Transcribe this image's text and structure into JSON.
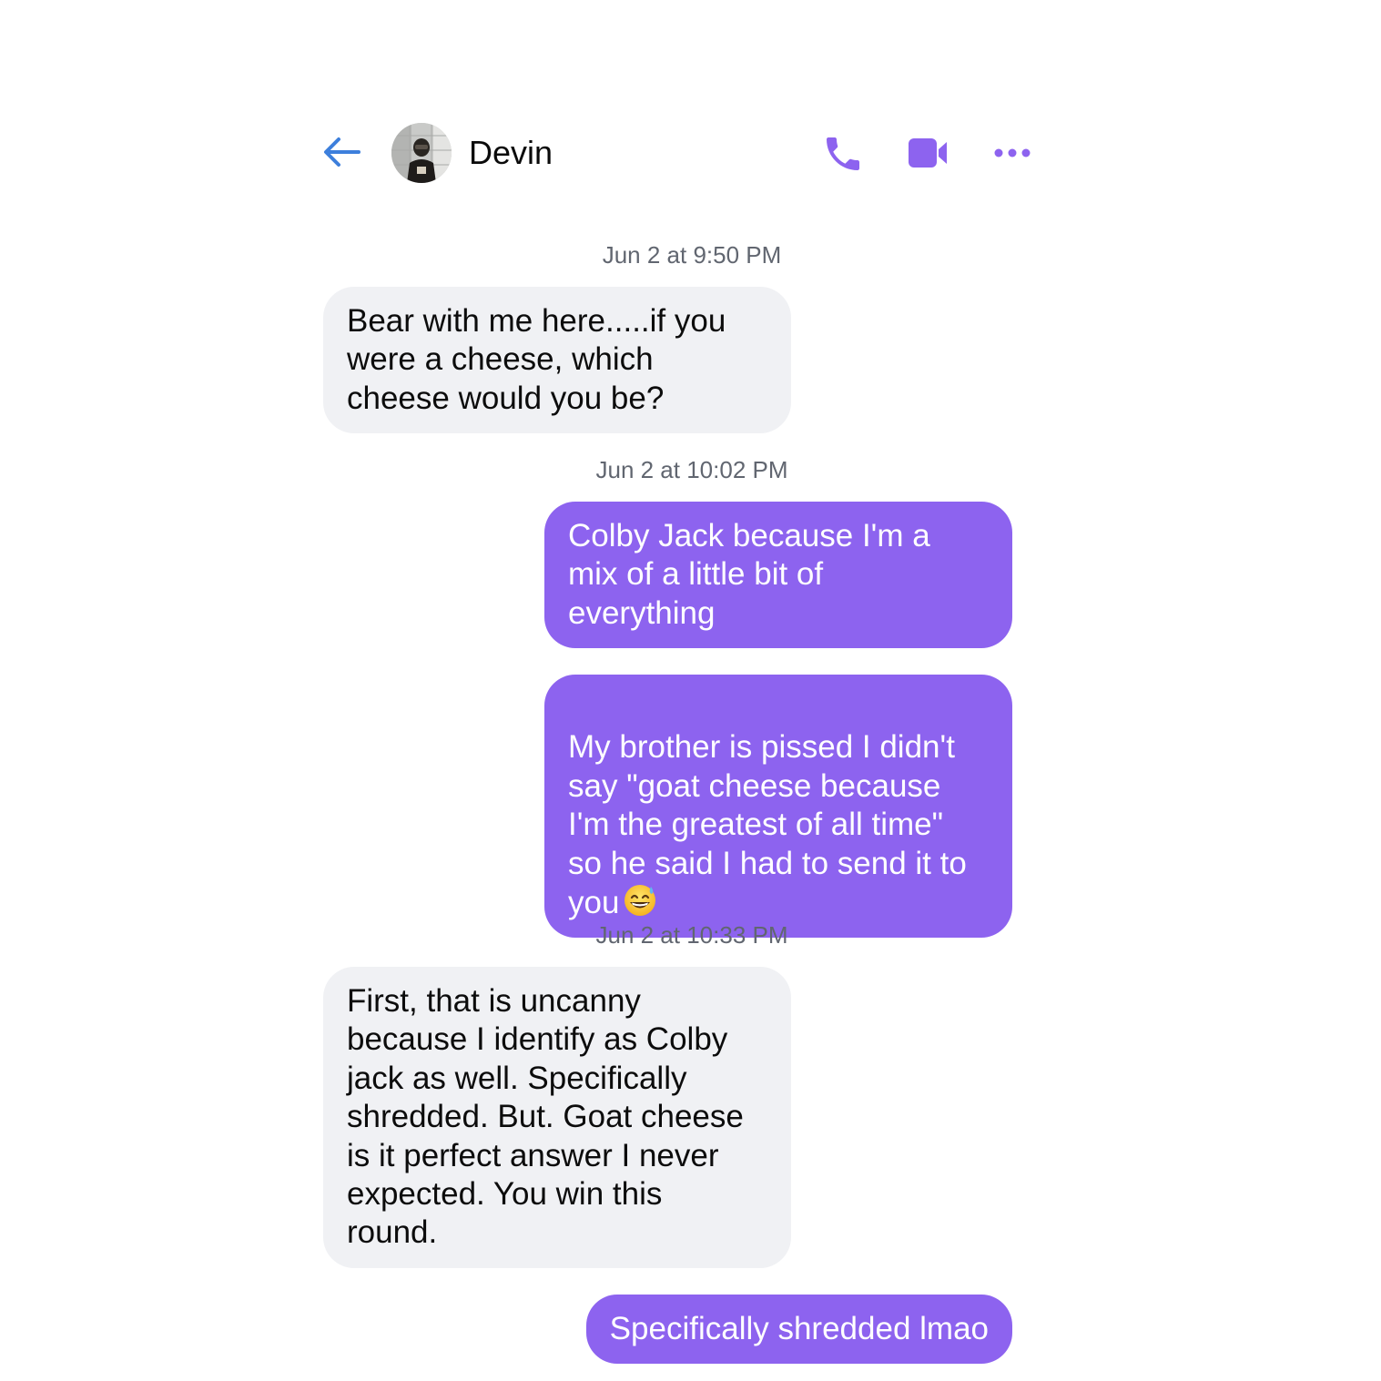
{
  "header": {
    "contact_name": "Devin"
  },
  "messages": [
    {
      "type": "timestamp",
      "text": "Jun 2 at 9:50 PM"
    },
    {
      "type": "incoming",
      "text": "Bear with me here.....if you\nwere a cheese, which\ncheese would you be?"
    },
    {
      "type": "timestamp",
      "text": "Jun 2 at 10:02 PM"
    },
    {
      "type": "outgoing",
      "text": "Colby Jack because I'm a\nmix of a little bit of\neverything"
    },
    {
      "type": "outgoing",
      "text": "My brother is pissed I didn't\nsay \"goat cheese because\nI'm the greatest of all time\"\nso he said I had to send it to\nyou",
      "emoji": "grinning-face-with-sweat-emoji"
    },
    {
      "type": "timestamp",
      "text": "Jun 2 at 10:33 PM"
    },
    {
      "type": "incoming",
      "text": "First, that is uncanny\nbecause I identify as Colby\njack as well. Specifically\nshredded.  But.  Goat cheese\nis it perfect answer I never\nexpected. You win this\nround."
    },
    {
      "type": "outgoing",
      "text": "Specifically shredded lmao"
    }
  ],
  "colors": {
    "accent": "#8d63ef",
    "back_arrow": "#3d7fdc",
    "incoming_bubble": "#f0f1f4",
    "timestamp_text": "#616670"
  },
  "icons": {
    "back": "back-arrow-icon",
    "call": "phone-icon",
    "video": "video-camera-icon",
    "more": "more-options-icon"
  }
}
